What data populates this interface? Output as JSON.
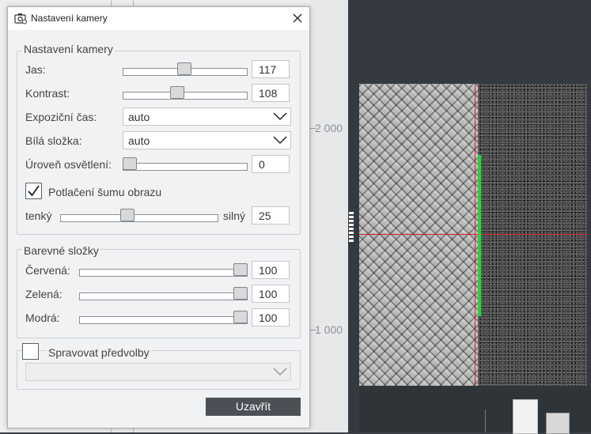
{
  "window": {
    "title": "Nastavení kamery"
  },
  "ruler": {
    "labels": [
      "2 000",
      "1 000"
    ]
  },
  "camera_group": {
    "title": "Nastavení kamery",
    "brightness": {
      "label": "Jas:",
      "value": "117",
      "level": 0.49
    },
    "contrast": {
      "label": "Kontrast:",
      "value": "108",
      "level": 0.43
    },
    "exposure": {
      "label": "Expoziční čas:",
      "value": "auto"
    },
    "white_balance": {
      "label": "Bílá složka:",
      "value": "auto"
    },
    "lighting": {
      "label": "Úroveň osvětlení:",
      "value": "0",
      "level": 0.0
    },
    "noise": {
      "label": "Potlačení šumu obrazu",
      "checked": true
    },
    "noise_slider": {
      "left_label": "tenký",
      "right_label": "silný",
      "value": "25",
      "level": 0.42
    }
  },
  "color_group": {
    "title": "Barevné složky",
    "red": {
      "label": "Červená:",
      "value": "100",
      "level": 1.0
    },
    "green": {
      "label": "Zelená:",
      "value": "100",
      "level": 1.0
    },
    "blue": {
      "label": "Modrá:",
      "value": "100",
      "level": 1.0
    }
  },
  "presets": {
    "label": "Spravovat předvolby",
    "checked": false,
    "value": ""
  },
  "buttons": {
    "close": "Uzavřít"
  },
  "icons": {
    "title": "camera-settings-icon",
    "close": "close-icon",
    "chevron": "chevron-down-icon",
    "check": "checkmark-icon"
  },
  "colors": {
    "accent_line_red": "#d0202a",
    "edge_marker_green": "#1ed83a"
  }
}
